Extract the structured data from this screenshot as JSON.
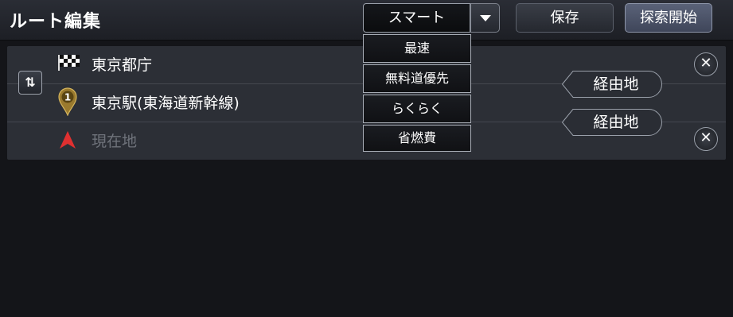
{
  "header": {
    "title": "ルート編集",
    "mode_selected": "スマート",
    "save_label": "保存",
    "search_start_label": "探索開始"
  },
  "route": {
    "destination": "東京都庁",
    "waypoint_number": "1",
    "waypoint": "東京駅(東海道新幹線)",
    "origin": "現在地",
    "via_label": "経由地",
    "close_glyph": "✕",
    "swap_glyph": "⇅"
  },
  "mode_menu": {
    "options": [
      "最速",
      "無料道優先",
      "らくらく",
      "省燃費"
    ]
  },
  "colors": {
    "background": "#141519",
    "panel": "#2c2f36",
    "pin": "#9a7a2e",
    "arrow": "#e03030"
  },
  "icons": {
    "destination": "checkered-flag-icon",
    "waypoint": "waypoint-pin-icon",
    "origin": "current-location-arrow-icon",
    "dropdown": "chevron-down-icon"
  }
}
